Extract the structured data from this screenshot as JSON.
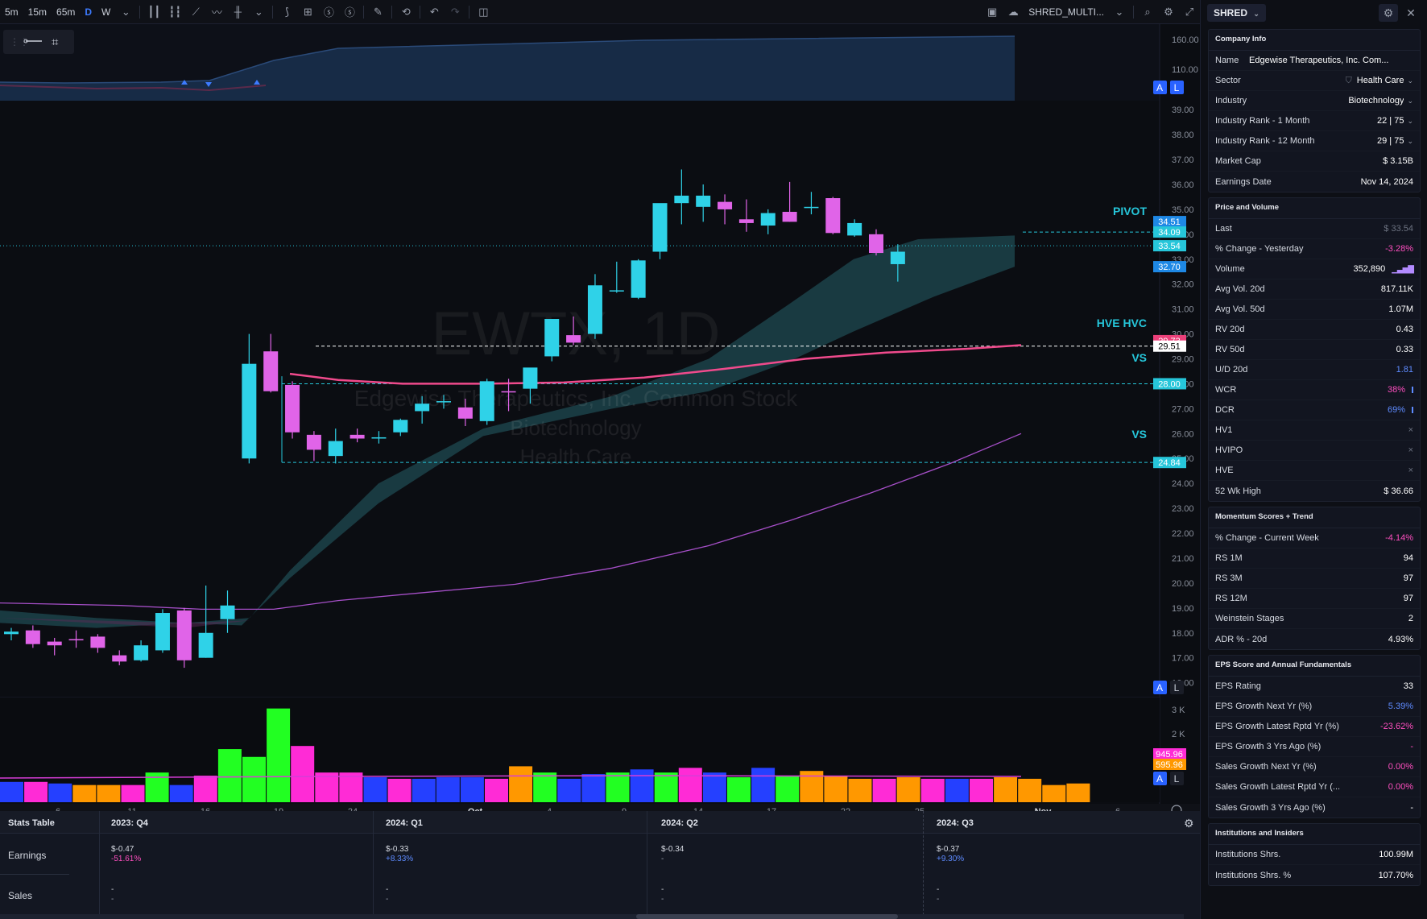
{
  "toolbar": {
    "timeframes": [
      "5m",
      "15m",
      "65m",
      "D",
      "W"
    ],
    "active_timeframe": "D",
    "layout_name": "SHRED_MULTI..."
  },
  "chart": {
    "watermark": {
      "symbol": "EWTX, 1D",
      "company": "Edgewise Therapeutics, Inc. Common Stock",
      "industry": "Biotechnology",
      "sector": "Health Care"
    },
    "price_axis": [
      "39.00",
      "38.00",
      "37.00",
      "36.00",
      "35.00",
      "34.00",
      "33.00",
      "32.00",
      "31.00",
      "30.00",
      "29.00",
      "28.00",
      "27.00",
      "26.00",
      "25.00",
      "24.00",
      "23.00",
      "22.00",
      "21.00",
      "20.00",
      "19.00",
      "18.00",
      "17.00",
      "16.00"
    ],
    "upper_axis": [
      "160.00",
      "110.00"
    ],
    "volume_axis": [
      "3 K",
      "2 K"
    ],
    "date_axis": [
      "6",
      "11",
      "16",
      "19",
      "24",
      "Oct",
      "4",
      "9",
      "14",
      "17",
      "22",
      "25",
      "Nov",
      "6"
    ],
    "level_labels": {
      "pivot": "PIVOT",
      "hve": "HVE HVC",
      "vs1": "VS",
      "vs2": "VS"
    },
    "price_tags": [
      {
        "text": "34.51",
        "color": "#1e88e5"
      },
      {
        "text": "34.09",
        "color": "#26c6da"
      },
      {
        "text": "33.54",
        "color": "#26c6da"
      },
      {
        "text": "32.70",
        "color": "#1e88e5"
      },
      {
        "text": "29.73",
        "color": "#ec407a"
      },
      {
        "text": "29.51",
        "color": "#ffffff"
      },
      {
        "text": "28.00",
        "color": "#26c6da"
      },
      {
        "text": "24.84",
        "color": "#26c6da"
      }
    ],
    "volume_tags": [
      {
        "text": "945.96",
        "color": "#ff2bd6"
      },
      {
        "text": "595.96",
        "color": "#ff9800"
      }
    ],
    "scale_buttons": [
      "A",
      "L"
    ],
    "colors": {
      "up": "#2fd2e8",
      "down": "#e064e8",
      "ma_fast": "#f04a8c",
      "ma_slow": "#a64fc8",
      "cloud": "#1f4a52"
    }
  },
  "chart_data": {
    "type": "candlestick",
    "ohlc_sequence": [
      {
        "o": 17.95,
        "h": 18.2,
        "l": 17.7,
        "c": 18.05
      },
      {
        "o": 18.1,
        "h": 18.3,
        "l": 17.4,
        "c": 17.55
      },
      {
        "o": 17.65,
        "h": 17.8,
        "l": 17.1,
        "c": 17.5
      },
      {
        "o": 17.75,
        "h": 18.1,
        "l": 17.4,
        "c": 17.7
      },
      {
        "o": 17.85,
        "h": 17.95,
        "l": 17.2,
        "c": 17.4
      },
      {
        "o": 17.1,
        "h": 17.3,
        "l": 16.7,
        "c": 16.85
      },
      {
        "o": 16.9,
        "h": 17.7,
        "l": 16.85,
        "c": 17.5
      },
      {
        "o": 17.3,
        "h": 18.95,
        "l": 17.2,
        "c": 18.8
      },
      {
        "o": 18.9,
        "h": 19.0,
        "l": 16.6,
        "c": 16.9
      },
      {
        "o": 17.0,
        "h": 19.9,
        "l": 17.0,
        "c": 18.0
      },
      {
        "o": 18.55,
        "h": 19.7,
        "l": 18.0,
        "c": 19.1
      },
      {
        "o": 25.0,
        "h": 30.0,
        "l": 24.8,
        "c": 28.8
      },
      {
        "o": 29.3,
        "h": 30.0,
        "l": 27.65,
        "c": 27.7
      },
      {
        "o": 27.95,
        "h": 28.1,
        "l": 25.8,
        "c": 26.05
      },
      {
        "o": 25.95,
        "h": 26.1,
        "l": 24.9,
        "c": 25.35
      },
      {
        "o": 25.1,
        "h": 26.2,
        "l": 24.8,
        "c": 25.7
      },
      {
        "o": 25.95,
        "h": 26.2,
        "l": 25.65,
        "c": 25.8
      },
      {
        "o": 25.8,
        "h": 26.1,
        "l": 25.6,
        "c": 25.85
      },
      {
        "o": 26.05,
        "h": 26.6,
        "l": 25.9,
        "c": 26.55
      },
      {
        "o": 26.9,
        "h": 27.5,
        "l": 26.4,
        "c": 27.2
      },
      {
        "o": 27.3,
        "h": 27.55,
        "l": 27.0,
        "c": 27.3
      },
      {
        "o": 27.05,
        "h": 27.4,
        "l": 26.3,
        "c": 26.6
      },
      {
        "o": 26.5,
        "h": 28.2,
        "l": 26.35,
        "c": 28.1
      },
      {
        "o": 27.7,
        "h": 28.2,
        "l": 26.9,
        "c": 27.65
      },
      {
        "o": 27.8,
        "h": 28.6,
        "l": 27.2,
        "c": 28.65
      },
      {
        "o": 29.1,
        "h": 30.5,
        "l": 28.9,
        "c": 30.6
      },
      {
        "o": 29.95,
        "h": 30.7,
        "l": 29.55,
        "c": 29.65
      },
      {
        "o": 30.0,
        "h": 32.4,
        "l": 29.8,
        "c": 31.95
      },
      {
        "o": 31.75,
        "h": 32.9,
        "l": 31.65,
        "c": 31.75
      },
      {
        "o": 31.45,
        "h": 33.0,
        "l": 31.4,
        "c": 32.95
      },
      {
        "o": 33.3,
        "h": 35.2,
        "l": 33.0,
        "c": 35.25
      },
      {
        "o": 35.25,
        "h": 36.6,
        "l": 34.4,
        "c": 35.55
      },
      {
        "o": 35.1,
        "h": 36.0,
        "l": 34.5,
        "c": 35.55
      },
      {
        "o": 35.3,
        "h": 35.6,
        "l": 34.4,
        "c": 35.0
      },
      {
        "o": 34.6,
        "h": 35.4,
        "l": 34.1,
        "c": 34.45
      },
      {
        "o": 34.35,
        "h": 35.0,
        "l": 34.0,
        "c": 34.85
      },
      {
        "o": 34.9,
        "h": 36.1,
        "l": 34.5,
        "c": 34.5
      },
      {
        "o": 35.1,
        "h": 35.7,
        "l": 34.8,
        "c": 35.1
      },
      {
        "o": 35.45,
        "h": 35.5,
        "l": 34.0,
        "c": 34.05
      },
      {
        "o": 33.95,
        "h": 34.6,
        "l": 33.9,
        "c": 34.45
      },
      {
        "o": 34.0,
        "h": 34.2,
        "l": 33.15,
        "c": 33.25
      },
      {
        "o": 32.8,
        "h": 33.6,
        "l": 32.1,
        "c": 33.3
      }
    ],
    "volumes_k": [
      0.65,
      0.65,
      0.6,
      0.55,
      0.55,
      0.55,
      0.95,
      0.55,
      0.85,
      1.7,
      1.45,
      3.0,
      1.8,
      0.95,
      0.95,
      0.8,
      0.75,
      0.75,
      0.8,
      0.8,
      0.75,
      1.15,
      0.95,
      0.75,
      0.9,
      0.95,
      1.05,
      0.95,
      1.1,
      0.95,
      0.8,
      1.1,
      0.85,
      1.0,
      0.85,
      0.75,
      0.75,
      0.8,
      0.75,
      0.75,
      0.75,
      0.8,
      0.75,
      0.55,
      0.6
    ],
    "levels": {
      "pivot": 34.09,
      "hve": 29.51,
      "vs1": 28.0,
      "vs2": 24.84,
      "last": 33.54
    },
    "ylim": [
      15.6,
      39.2
    ],
    "volume_ylim": [
      0,
      3.3
    ]
  },
  "stats_table": {
    "title": "Stats Table",
    "columns": [
      "2023: Q4",
      "2024: Q1",
      "2024: Q2",
      "2024: Q3"
    ],
    "rows": [
      {
        "label": "Earnings",
        "values": [
          "$-0.47",
          "$-0.33",
          "$-0.34",
          "$-0.37"
        ],
        "changes": [
          "-51.61%",
          "+8.33%",
          "-",
          "+9.30%"
        ]
      },
      {
        "label": "Sales",
        "values": [
          "-",
          "-",
          "-",
          "-"
        ],
        "changes": [
          "-",
          "-",
          "-",
          "-"
        ]
      }
    ]
  },
  "panel": {
    "layout_button": "SHRED",
    "company_info": {
      "title": "Company Info",
      "rows": [
        {
          "k": "Name",
          "v": "Edgewise Therapeutics, Inc. Com..."
        },
        {
          "k": "Sector",
          "v": "Health Care"
        },
        {
          "k": "Industry",
          "v": "Biotechnology"
        },
        {
          "k": "Industry Rank - 1 Month",
          "v": "22 | 75"
        },
        {
          "k": "Industry Rank - 12 Month",
          "v": "29 | 75"
        },
        {
          "k": "Market Cap",
          "v": "$ 3.15B"
        },
        {
          "k": "Earnings Date",
          "v": "Nov 14, 2024"
        }
      ]
    },
    "price_volume": {
      "title": "Price and Volume",
      "rows": [
        {
          "k": "Last",
          "v": "$ 33.54",
          "c": "muted"
        },
        {
          "k": "% Change - Yesterday",
          "v": "-3.28%",
          "c": "neg"
        },
        {
          "k": "Volume",
          "v": "352,890",
          "c": ""
        },
        {
          "k": "Avg Vol. 20d",
          "v": "817.11K",
          "c": ""
        },
        {
          "k": "Avg Vol. 50d",
          "v": "1.07M",
          "c": ""
        },
        {
          "k": "RV 20d",
          "v": "0.43",
          "c": ""
        },
        {
          "k": "RV 50d",
          "v": "0.33",
          "c": ""
        },
        {
          "k": "U/D 20d",
          "v": "1.81",
          "c": "pos"
        },
        {
          "k": "WCR",
          "v": "38%",
          "c": "neg"
        },
        {
          "k": "DCR",
          "v": "69%",
          "c": "pos"
        },
        {
          "k": "HV1",
          "v": "×",
          "c": "muted"
        },
        {
          "k": "HVIPO",
          "v": "×",
          "c": "muted"
        },
        {
          "k": "HVE",
          "v": "×",
          "c": "muted"
        },
        {
          "k": "52 Wk High",
          "v": "$ 36.66",
          "c": ""
        }
      ]
    },
    "momentum": {
      "title": "Momentum Scores + Trend",
      "rows": [
        {
          "k": "% Change - Current Week",
          "v": "-4.14%",
          "c": "neg"
        },
        {
          "k": "RS 1M",
          "v": "94",
          "c": ""
        },
        {
          "k": "RS 3M",
          "v": "97",
          "c": ""
        },
        {
          "k": "RS 12M",
          "v": "97",
          "c": ""
        },
        {
          "k": "Weinstein Stages",
          "v": "2",
          "c": ""
        },
        {
          "k": "ADR % - 20d",
          "v": "4.93%",
          "c": ""
        }
      ]
    },
    "eps": {
      "title": "EPS Score and Annual Fundamentals",
      "rows": [
        {
          "k": "EPS Rating",
          "v": "33",
          "c": ""
        },
        {
          "k": "EPS Growth Next Yr (%)",
          "v": "5.39%",
          "c": "pos"
        },
        {
          "k": "EPS Growth Latest Rptd Yr (%)",
          "v": "-23.62%",
          "c": "neg"
        },
        {
          "k": "EPS Growth 3 Yrs Ago (%)",
          "v": "-",
          "c": "neg"
        },
        {
          "k": "Sales Growth Next Yr (%)",
          "v": "0.00%",
          "c": "neg"
        },
        {
          "k": "Sales Growth Latest Rptd Yr (...",
          "v": "0.00%",
          "c": "neg"
        },
        {
          "k": "Sales Growth 3 Yrs Ago (%)",
          "v": "-",
          "c": ""
        }
      ]
    },
    "institutions": {
      "title": "Institutions and Insiders",
      "rows": [
        {
          "k": "Institutions Shrs.",
          "v": "100.99M",
          "c": ""
        },
        {
          "k": "Institutions Shrs. %",
          "v": "107.70%",
          "c": ""
        }
      ]
    }
  }
}
